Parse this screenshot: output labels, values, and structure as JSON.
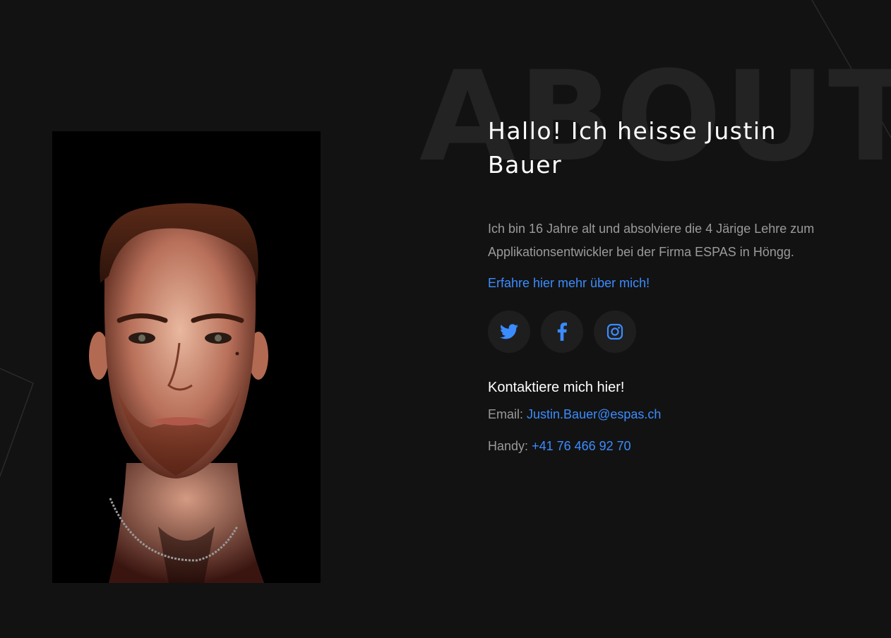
{
  "section": {
    "watermark": "ABOUT",
    "title": "Hallo! Ich heisse Justin Bauer",
    "bio": "Ich bin 16 Jahre alt und absolviere die 4 Järige Lehre zum Applikationsentwickler bei der Firma ESPAS in Höngg.",
    "more_link": "Erfahre hier mehr über mich!",
    "socials": [
      {
        "icon": "twitter-icon"
      },
      {
        "icon": "facebook-icon"
      },
      {
        "icon": "instagram-icon"
      }
    ],
    "contact_heading": "Kontaktiere mich hier!",
    "email_label": "Email:",
    "email_value": "Justin.Bauer@espas.ch",
    "phone_label": "Handy:",
    "phone_value": "+41 76 466 92 70"
  },
  "colors": {
    "background": "#121212",
    "accent": "#3b8cff",
    "text_muted": "#9a9a9a",
    "text_light": "#ffffff",
    "social_bg": "#1e1e1e"
  }
}
